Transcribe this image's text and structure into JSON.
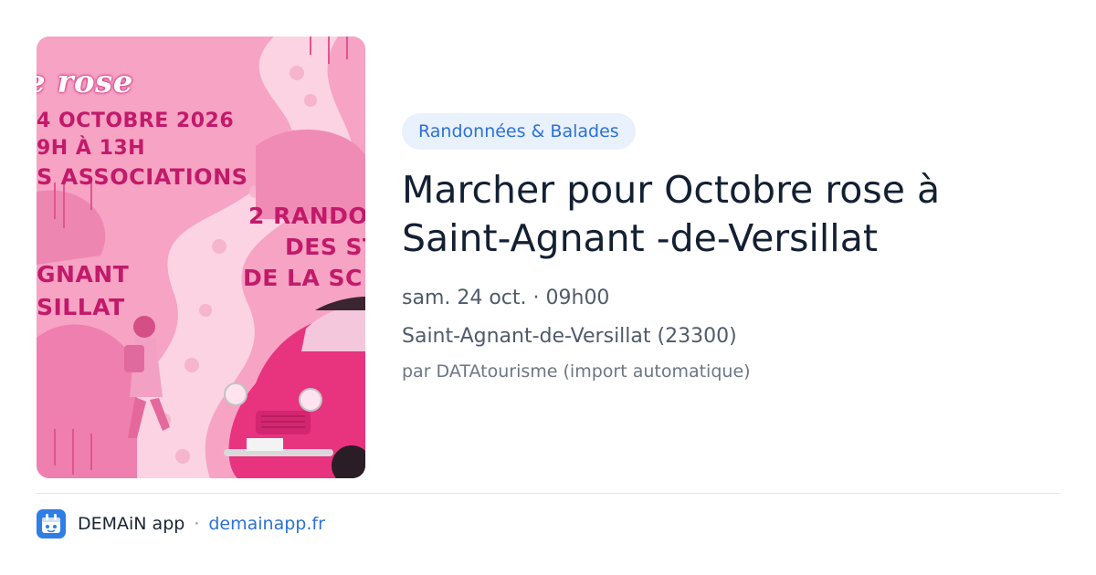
{
  "poster": {
    "script_word": "e rose",
    "date_line": "4 OCTOBRE 2026",
    "hours_line": "9H À 13H",
    "assoc_line": "S ASSOCIATIONS",
    "rando_line1": "2 RANDO",
    "rando_line2": "DES ST",
    "rando_line3": "DE LA SC",
    "town_line1": "GNANT",
    "town_line2": "SILLAT"
  },
  "event": {
    "category": "Randonnées & Balades",
    "title": "Marcher pour Octobre rose à Saint-Agnant -de-Versillat",
    "datetime": "sam. 24 oct. · 09h00",
    "location": "Saint-Agnant-de-Versillat (23300)",
    "source": "par DATAtourisme (import automatique)"
  },
  "footer": {
    "app_name": "DEMAiN app",
    "separator": "·",
    "domain": "demainapp.fr"
  },
  "colors": {
    "accent": "#2d70d8",
    "pill_bg": "#e9f1fc",
    "title": "#132033",
    "poster_pink": "#f7a9c9",
    "car_pink": "#e8337f"
  },
  "icons": {
    "app_icon": "demain-app-icon"
  }
}
